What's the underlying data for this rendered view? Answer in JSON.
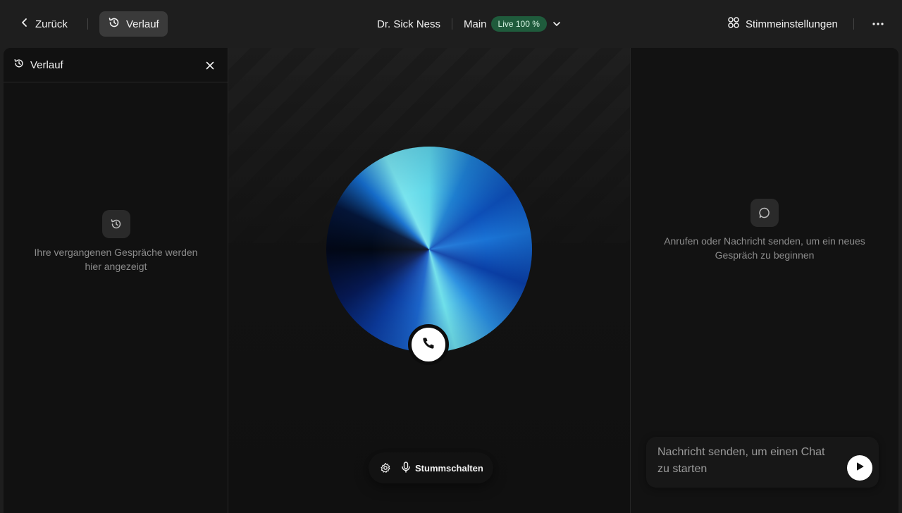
{
  "topbar": {
    "back_label": "Zurück",
    "history_label": "Verlauf",
    "agent_name": "Dr. Sick Ness",
    "branch": "Main",
    "live_badge": "Live 100 %",
    "voice_settings_label": "Stimmeinstellungen"
  },
  "history_panel": {
    "title": "Verlauf",
    "empty_text": "Ihre vergangenen Gespräche werden hier angezeigt"
  },
  "stage": {
    "mute_label": "Stummschalten"
  },
  "chat_panel": {
    "empty_text": "Anrufen oder Nachricht senden, um ein neues Gespräch zu beginnen",
    "composer_placeholder": "Nachricht senden, um einen Chat zu starten"
  },
  "colors": {
    "live_badge_bg": "#1f5b3c",
    "accent_orb": "#1a74d6"
  }
}
